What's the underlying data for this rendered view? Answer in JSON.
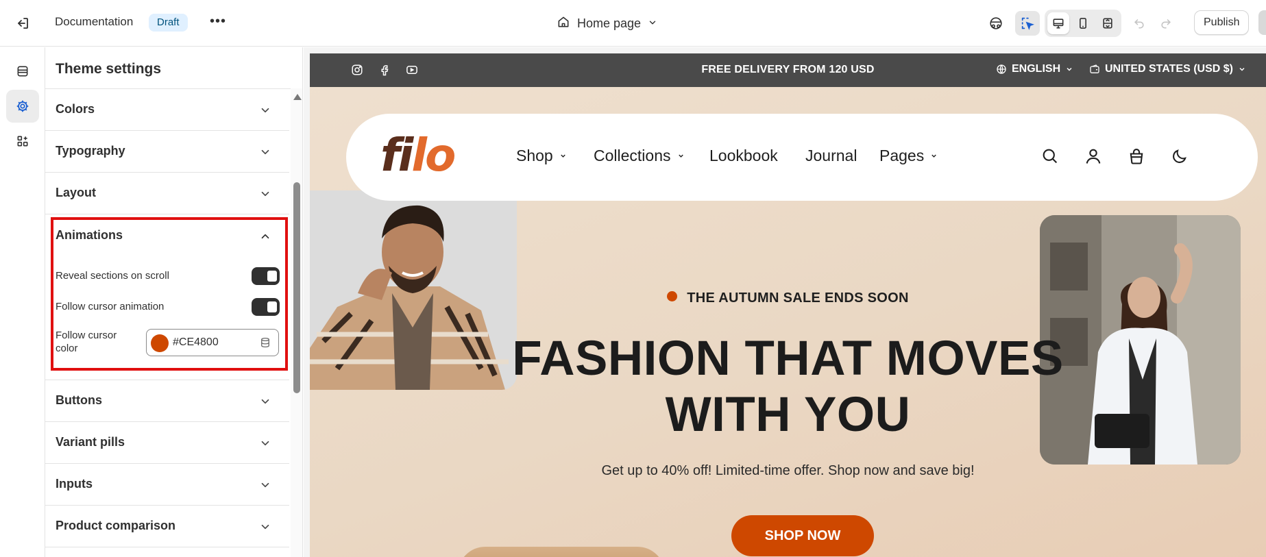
{
  "topbar": {
    "document_name": "Documentation",
    "status_badge": "Draft",
    "more_label": "•••",
    "page_selector": "Home page",
    "publish_label": "Publish"
  },
  "panel": {
    "title": "Theme settings",
    "sections": {
      "colors": "Colors",
      "typography": "Typography",
      "layout": "Layout",
      "animations": "Animations",
      "buttons": "Buttons",
      "variant_pills": "Variant pills",
      "inputs": "Inputs",
      "product_comparison": "Product comparison"
    },
    "animations": {
      "reveal_label": "Reveal sections on scroll",
      "reveal_on": true,
      "follow_label": "Follow cursor animation",
      "follow_on": true,
      "color_label": "Follow cursor color",
      "color_value": "#CE4800"
    }
  },
  "store": {
    "announcement": "FREE DELIVERY FROM 120 USD",
    "language": "ENGLISH",
    "currency": "UNITED STATES (USD $)",
    "logo_part1": "fi",
    "logo_part2": "lo",
    "nav": {
      "shop": "Shop",
      "collections": "Collections",
      "lookbook": "Lookbook",
      "journal": "Journal",
      "pages": "Pages"
    },
    "hero": {
      "eyebrow": "THE AUTUMN SALE ENDS SOON",
      "title_line1": "FASHION THAT MOVES",
      "title_line2": "WITH YOU",
      "subtitle": "Get up to 40% off! Limited-time offer. Shop now and save big!",
      "cta": "SHOP NOW"
    }
  },
  "colors": {
    "accent": "#CE4800",
    "highlight_border": "#E01010",
    "badge_bg": "#E0F0FF",
    "announcement_bg": "#4A4A4A"
  }
}
